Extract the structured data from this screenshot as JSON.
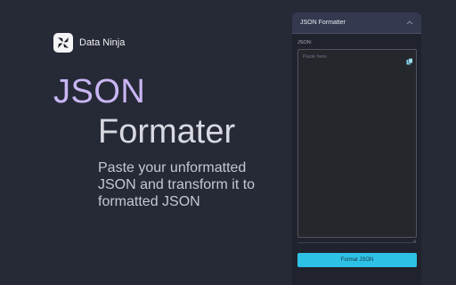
{
  "brand": {
    "name": "Data Ninja",
    "logo_icon": "shuriken-icon"
  },
  "hero": {
    "title_line1": "JSON",
    "title_line2": "Formater",
    "description": "Paste your unformatted JSON and transform it to formatted JSON"
  },
  "panel": {
    "title": "JSON Formatter",
    "collapse_icon": "chevron-up-icon",
    "field_label": "JSON:",
    "input_placeholder": "Paste here.",
    "input_value": "",
    "copy_icon": "copy-icon",
    "button_label": "Format JSON"
  },
  "colors": {
    "background": "#262936",
    "accent": "#2ec1e6",
    "title_purple": "#c9b6f4",
    "panel_header": "#34394f"
  }
}
